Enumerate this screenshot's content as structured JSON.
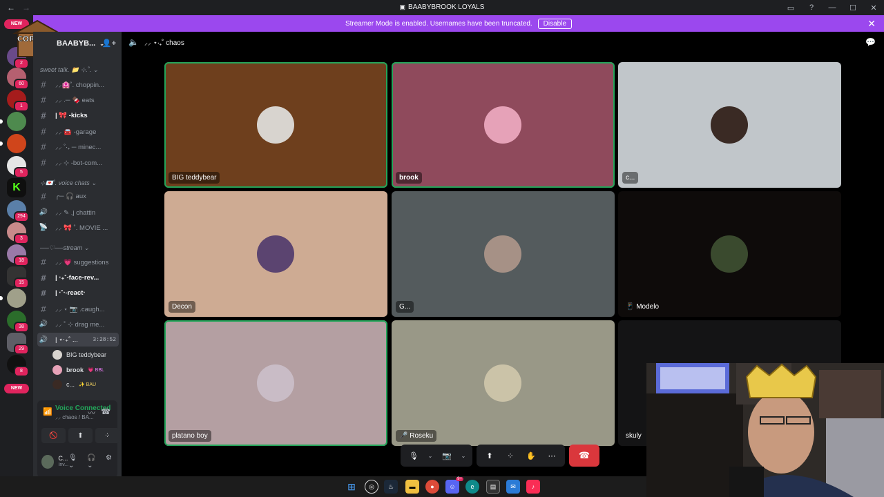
{
  "window": {
    "title": "BAABYBROOK LOYALS",
    "back": "←",
    "forward": "→"
  },
  "banner": {
    "text": "Streamer Mode is enabled. Usernames have been truncated.",
    "button": "Disable",
    "close": "✕"
  },
  "rail": {
    "new_top": "NEW",
    "new_bottom": "NEW",
    "logo_text": "CORPSKII",
    "badges": [
      "2",
      "60",
      "1",
      "5",
      "294",
      "3",
      "18",
      "15",
      "38",
      "29",
      "8"
    ]
  },
  "server": {
    "name": "BAABYB...",
    "chevron": "⌄",
    "invite": "👤+"
  },
  "categories": {
    "sweet_talk": "sweet talk. 📁 ⊹.˚.  ⌄",
    "voice_chats": "⊹💌˚. voice chats ⌄",
    "stream": "──♡──stream ⌄"
  },
  "channels": [
    {
      "icon": "#",
      "label": "⸝⸝🏩˚. choppin..."
    },
    {
      "icon": "#",
      "label": "⸝⸝ .─ 🍫 eats"
    },
    {
      "icon": "#",
      "label": "| 🎀 -kicks"
    },
    {
      "icon": "#",
      "label": "⸝⸝ 🚘 -garage"
    },
    {
      "icon": "#",
      "label": "⸝⸝ ˚‧₊ ─ minec..."
    },
    {
      "icon": "#",
      "label": "⸝⸝ ⊹ -bot-com..."
    },
    {
      "icon": "#",
      "label": "╭─ 🎧 aux"
    },
    {
      "icon": "🔊",
      "label": "⸝⸝ ✎ .j chattin"
    },
    {
      "icon": "📡",
      "label": "⸝⸝ 🎀 ˚. MOVIE ..."
    },
    {
      "icon": "#",
      "label": "⸝⸝ 💗 suggestions"
    },
    {
      "icon": "#",
      "label": "| ‧₊˚-face-rev..."
    },
    {
      "icon": "#",
      "label": "| ‧˚‧-react‧"
    },
    {
      "icon": "#",
      "label": "⸝⸝ ⋆ 📷 .caugh..."
    },
    {
      "icon": "🔊",
      "label": "⸝⸝ ˚ ⊹ drag me..."
    },
    {
      "icon": "🔊",
      "label": "| ⋆‧₊˚ ...",
      "timer": "3:28:52"
    }
  ],
  "voice_users": [
    {
      "name": "BIG teddybear",
      "badge": ""
    },
    {
      "name": "brook",
      "badge": "💗 BBL"
    },
    {
      "name": "c...",
      "badge": "✨ BAU"
    }
  ],
  "voice_panel": {
    "status": "Voice Connected",
    "subtitle": "⸝⸝ chaos / BA...",
    "signal_icon": "📶",
    "wave_icon": "〰",
    "hangup_icon": "☎",
    "buttons": [
      "🚫",
      "⬆",
      "⁘",
      "✋"
    ]
  },
  "user": {
    "name": "C...",
    "status": "Inv...",
    "mic": "🎙 ⌄",
    "headset": "🎧 ⌄",
    "settings": "⚙"
  },
  "stage": {
    "channel": "⸝⸝ ⋆‧₊˚ chaos",
    "speaker_icon": "🔈",
    "chat_icon": "💬"
  },
  "tiles": [
    {
      "name": "BIG teddybear",
      "bg": "#6e3f1d",
      "avatar": "#d8d4cf",
      "speaking": true
    },
    {
      "name": "brook",
      "bg": "#8f4a5c",
      "avatar": "#e6a2b8",
      "speaking": true
    },
    {
      "name": "c...",
      "bg": "#c1c6ca",
      "avatar": "#3a2a24",
      "speaking": false
    },
    {
      "name": "Decon",
      "bg": "#ceab93",
      "avatar": "#5b4470",
      "speaking": false
    },
    {
      "name": "G...",
      "bg": "#545b5d",
      "avatar": "#a69186",
      "speaking": false
    },
    {
      "name": "📱 Modelo",
      "bg": "#0e0b0a",
      "avatar": "#3a4a2e",
      "speaking": false
    },
    {
      "name": "platano boy",
      "bg": "#b49fa2",
      "avatar": "#c9bcc6",
      "speaking": true
    },
    {
      "name": "🎤 Roseku",
      "bg": "#999887",
      "avatar": "#cbc3a8",
      "speaking": false
    },
    {
      "name": "skuly",
      "bg": "#141415",
      "avatar": "#141415",
      "speaking": false
    }
  ],
  "controls": {
    "mic": "🎙",
    "camera": "📷",
    "chevron": "⌄",
    "share": "⬆",
    "activities": "⁘",
    "soundboard": "✋",
    "more": "⋯",
    "hangup": "☎"
  },
  "taskbar": {
    "chat_badge": "9+"
  },
  "colors": {
    "banner": "#9b48ee",
    "speaking": "#23a55a",
    "hangup": "#da373c",
    "badge": "#e0245e"
  }
}
